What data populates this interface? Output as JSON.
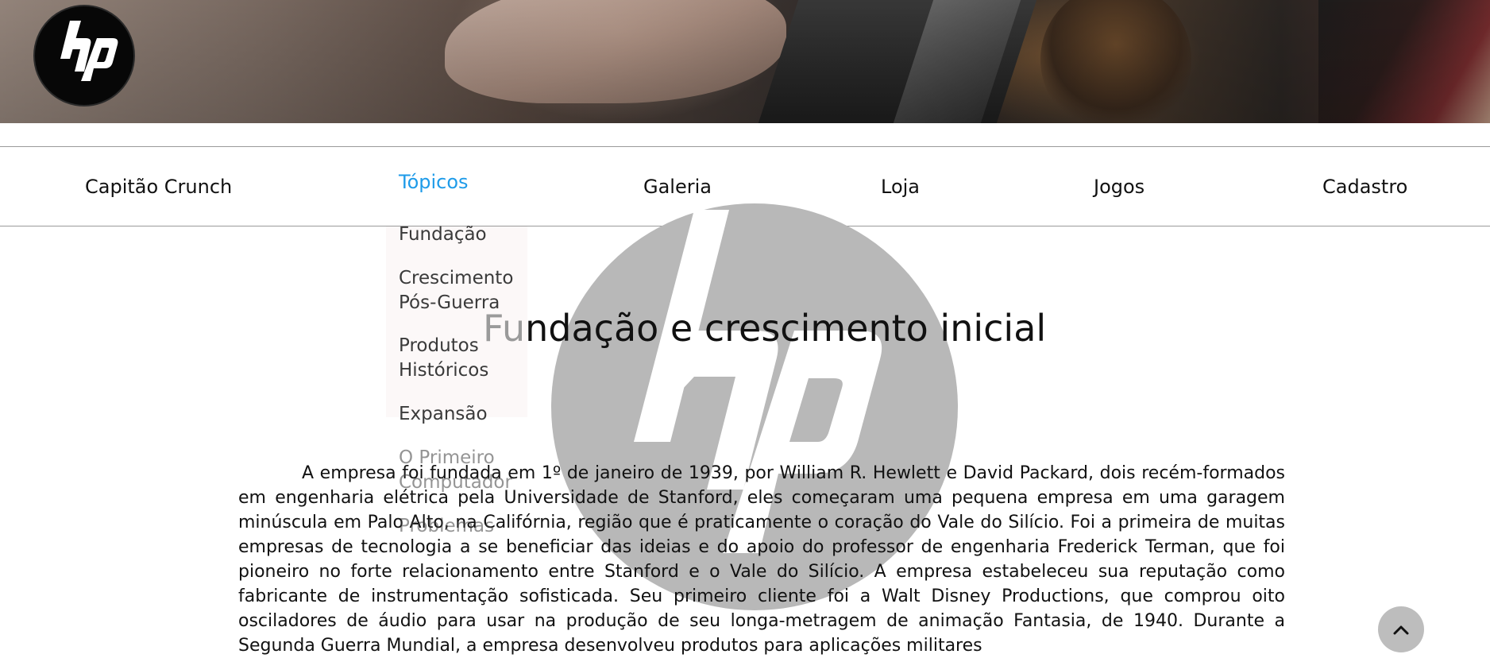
{
  "brand": {
    "logo_icon": "hp-logo-icon"
  },
  "nav": {
    "items": [
      {
        "label": "Capitão Crunch",
        "active": false
      },
      {
        "label": "Tópicos",
        "active": true
      },
      {
        "label": "Galeria",
        "active": false
      },
      {
        "label": "Loja",
        "active": false
      },
      {
        "label": "Jogos",
        "active": false
      },
      {
        "label": "Cadastro",
        "active": false
      }
    ],
    "active_color": "#1e9be9"
  },
  "dropdown": {
    "items": [
      {
        "label": "Fundação"
      },
      {
        "label": "Crescimento Pós-Guerra"
      },
      {
        "label": "Produtos Históricos"
      },
      {
        "label": "Expansão"
      },
      {
        "label": "O Primeiro Computador"
      },
      {
        "label": "Problemas"
      }
    ]
  },
  "main": {
    "heading_first": "F",
    "heading_second": "u",
    "heading_rest": "ndação e crescimento inicial",
    "paragraph": "A empresa foi fundada em 1º de janeiro de 1939, por William R. Hewlett e David Packard, dois recém-formados em engenharia elétrica pela Universidade de Stanford, eles começaram uma pequena empresa em uma garagem minúscula em Palo Alto, na Califórnia, região que é praticamente o coração do Vale do Silício. Foi a primeira de muitas empresas de tecnologia a se beneficiar das ideias e do apoio do professor de engenharia Frederick Terman, que foi pioneiro no forte relacionamento entre Stanford e o Vale do Silício. A empresa estabeleceu sua reputação como fabricante de instrumentação sofisticada. Seu primeiro cliente foi a Walt Disney Productions, que comprou oito osciladores de áudio para usar na produção de seu longa-metragem de animação Fantasia, de 1940. Durante a Segunda Guerra Mundial, a empresa desenvolveu produtos para aplicações militares"
  },
  "back_to_top": {
    "icon": "chevron-up-icon"
  },
  "colors": {
    "watermark": "#b8b8b8",
    "back_to_top_bg": "#bdbdbd"
  }
}
